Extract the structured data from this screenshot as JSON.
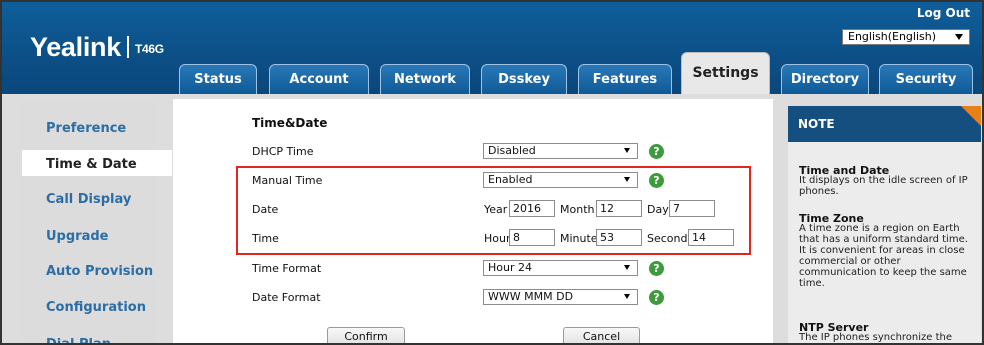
{
  "brand": {
    "logo": "Yealink",
    "model": "T46G"
  },
  "header": {
    "logout": "Log Out",
    "language": "English(English)"
  },
  "tabs": [
    {
      "label": "Status"
    },
    {
      "label": "Account"
    },
    {
      "label": "Network"
    },
    {
      "label": "Dsskey"
    },
    {
      "label": "Features"
    },
    {
      "label": "Settings",
      "active": true
    },
    {
      "label": "Directory"
    },
    {
      "label": "Security"
    }
  ],
  "sidebar": {
    "items": [
      {
        "label": "Preference"
      },
      {
        "label": "Time & Date",
        "active": true
      },
      {
        "label": "Call Display"
      },
      {
        "label": "Upgrade"
      },
      {
        "label": "Auto Provision"
      },
      {
        "label": "Configuration"
      },
      {
        "label": "Dial Plan"
      }
    ]
  },
  "form": {
    "section_title": "Time&Date",
    "dhcp_time": {
      "label": "DHCP Time",
      "value": "Disabled"
    },
    "manual_time": {
      "label": "Manual Time",
      "value": "Enabled"
    },
    "date": {
      "label": "Date",
      "year_label": "Year",
      "year": "2016",
      "month_label": "Month",
      "month": "12",
      "day_label": "Day",
      "day": "7"
    },
    "time": {
      "label": "Time",
      "hour_label": "Hour",
      "hour": "8",
      "minute_label": "Minute",
      "minute": "53",
      "second_label": "Second",
      "second": "14"
    },
    "time_format": {
      "label": "Time Format",
      "value": "Hour 24"
    },
    "date_format": {
      "label": "Date Format",
      "value": "WWW MMM DD"
    },
    "confirm": "Confirm",
    "cancel": "Cancel",
    "help_glyph": "?"
  },
  "note": {
    "header": "NOTE",
    "sections": [
      {
        "title": "Time and Date",
        "text": "It displays on the idle screen of IP phones."
      },
      {
        "title": "Time Zone",
        "text": "A time zone is a region on Earth that has a uniform standard time. It is convenient for areas in close commercial or other communication to keep the same time."
      },
      {
        "title": "NTP Server",
        "text": "The IP phones synchronize the"
      }
    ]
  },
  "colors": {
    "header_blue": "#0c4f86",
    "note_header": "#154f80",
    "accent_orange": "#e8801a",
    "help_green": "#3d9b3d",
    "highlight_red": "#e0261d",
    "link_blue": "#2d6da5"
  }
}
